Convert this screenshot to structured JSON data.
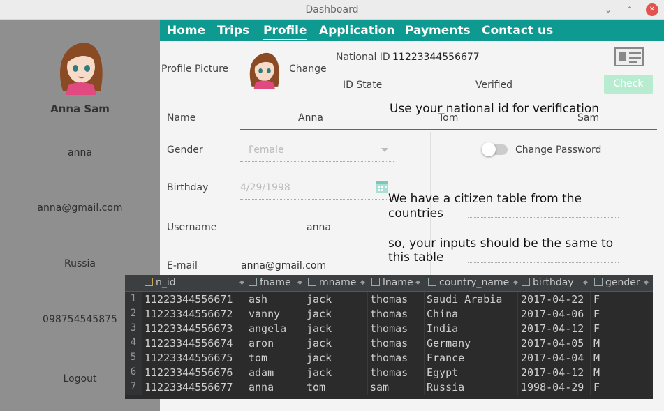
{
  "window": {
    "title": "Dashboard",
    "minimize": "⌄",
    "restore": "⌃",
    "close": "✕"
  },
  "sidebar": {
    "full_name": "Anna Sam",
    "username": "anna",
    "email": "anna@gmail.com",
    "country": "Russia",
    "phone": "098754545875",
    "logout": "Logout"
  },
  "nav": {
    "items": [
      {
        "label": "Home"
      },
      {
        "label": "Trips"
      },
      {
        "label": "Profile",
        "active": true
      },
      {
        "label": "Application"
      },
      {
        "label": "Payments"
      },
      {
        "label": "Contact us"
      }
    ]
  },
  "profile": {
    "picture_label": "Profile Picture",
    "change_label": "Change",
    "national_id_label": "National ID",
    "national_id_value": "11223344556677",
    "id_state_label": "ID State",
    "id_state_value": "Verified",
    "check_button": "Check",
    "name_label": "Name",
    "first_name": "Anna",
    "middle_name": "Tom",
    "last_name": "Sam",
    "gender_label": "Gender",
    "gender_value": "Female",
    "birthday_label": "Birthday",
    "birthday_value": "4/29/1998",
    "username_label": "Username",
    "username_value": "anna",
    "email_label": "E-mail",
    "email_value": "anna@gmail.com",
    "change_password_label": "Change Password"
  },
  "captions": {
    "verify": "Use your national id for verification",
    "citizen_line1": "We have a citizen table from the",
    "citizen_line2": "countries",
    "same_line1": "so, your inputs should be the same to",
    "same_line2": "this table"
  },
  "colors": {
    "nav": "#0e9a90",
    "sidebar": "#8f8f8f",
    "check_button": "#b8ecd0"
  },
  "table": {
    "columns": [
      "n_id",
      "fname",
      "mname",
      "lname",
      "country_name",
      "birthday",
      "gender"
    ],
    "rows": [
      [
        "1",
        "11223344556671",
        "ash",
        "jack",
        "thomas",
        "Saudi Arabia",
        "2017-04-22",
        "F"
      ],
      [
        "2",
        "11223344556672",
        "vanny",
        "jack",
        "thomas",
        "China",
        "2017-04-06",
        "F"
      ],
      [
        "3",
        "11223344556673",
        "angela",
        "jack",
        "thomas",
        "India",
        "2017-04-12",
        "F"
      ],
      [
        "4",
        "11223344556674",
        "aron",
        "jack",
        "thomas",
        "Germany",
        "2017-04-05",
        "M"
      ],
      [
        "5",
        "11223344556675",
        "tom",
        "jack",
        "thomas",
        "France",
        "2017-04-04",
        "M"
      ],
      [
        "6",
        "11223344556676",
        "adam",
        "jack",
        "thomas",
        "Egypt",
        "2017-04-12",
        "M"
      ],
      [
        "7",
        "11223344556677",
        "anna",
        "tom",
        "sam",
        "Russia",
        "1998-04-29",
        "F"
      ]
    ]
  }
}
